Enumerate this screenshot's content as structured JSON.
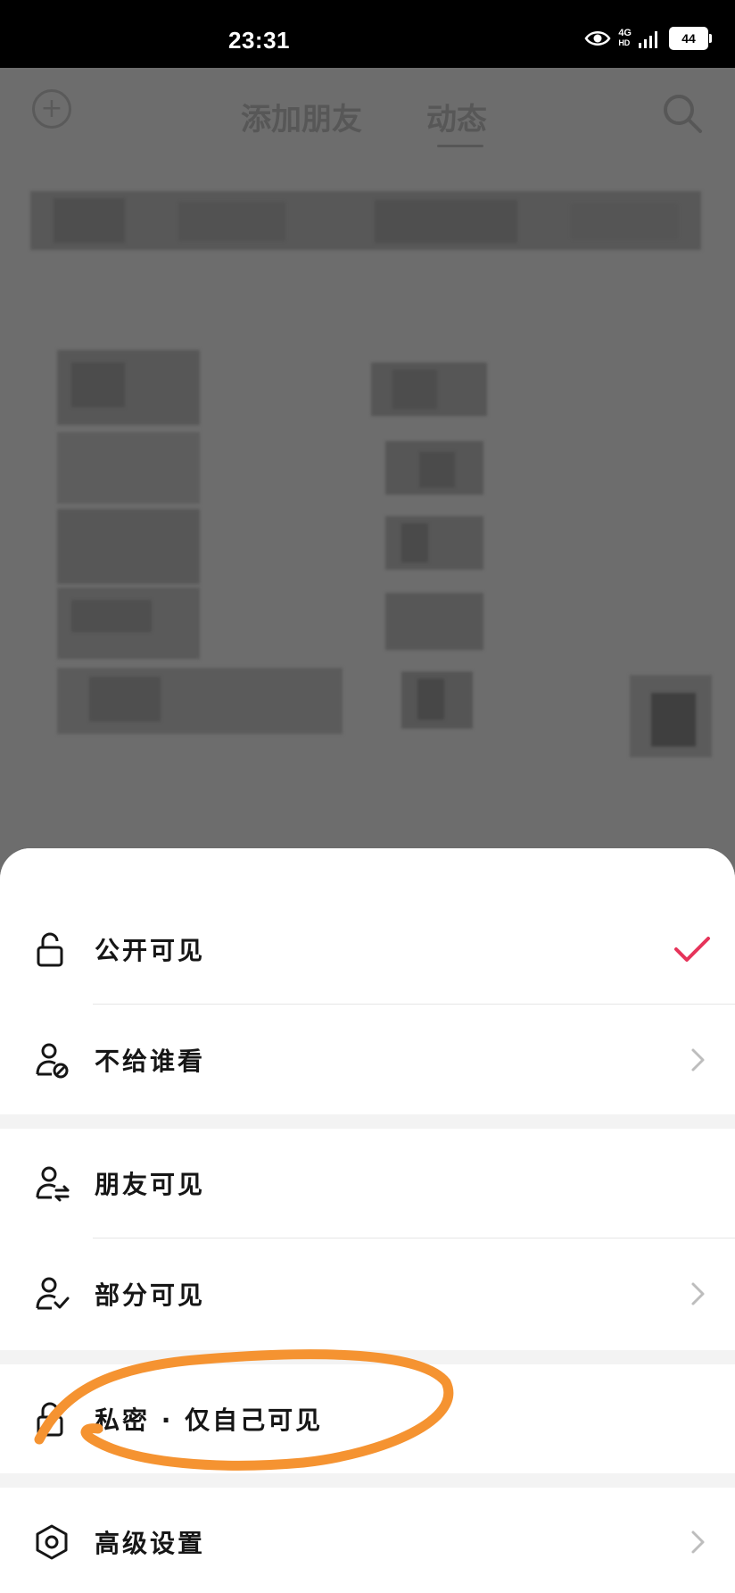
{
  "status_bar": {
    "time": "23:31",
    "network_top": "4G",
    "network_bottom": "HD",
    "battery": "44"
  },
  "background": {
    "nav": {
      "add_friend_tab": "添加朋友",
      "moments_tab": "动态"
    }
  },
  "sheet": {
    "options": [
      {
        "label": "公开可见",
        "icon": "unlock-icon",
        "selected": true
      },
      {
        "label": "不给谁看",
        "icon": "user-block-icon"
      },
      {
        "label": "朋友可见",
        "icon": "user-friends-icon"
      },
      {
        "label": "部分可见",
        "icon": "user-check-icon"
      },
      {
        "label": "私密 · 仅自己可见",
        "icon": "lock-icon"
      },
      {
        "label": "高级设置",
        "icon": "settings-icon"
      }
    ]
  },
  "colors": {
    "accent": "#e6345a",
    "annotation": "#f59331"
  }
}
